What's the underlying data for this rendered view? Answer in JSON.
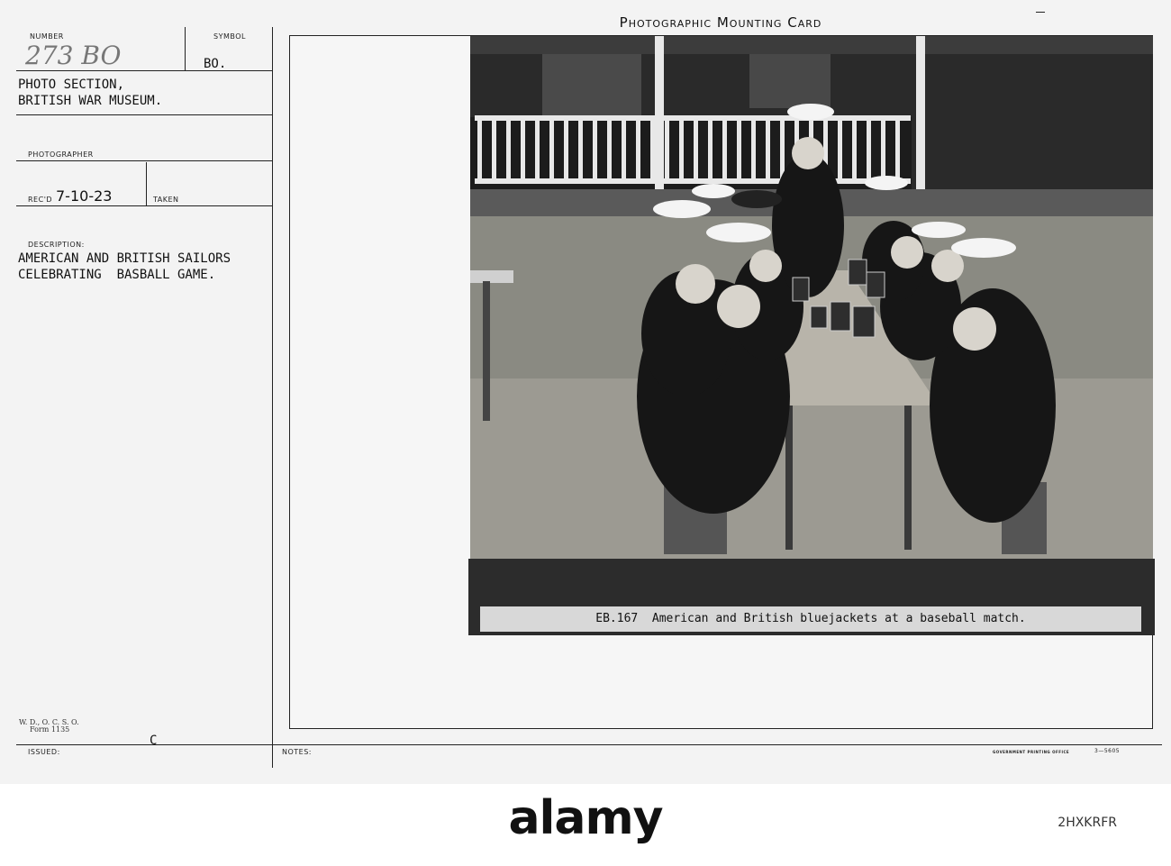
{
  "card": {
    "title": "Photographic Mounting Card",
    "number_label": "NUMBER",
    "number_value": "273 BO",
    "symbol_label": "SYMBOL",
    "symbol_value": "BO.",
    "source_line1": "PHOTO SECTION,",
    "source_line2": "BRITISH WAR MUSEUM.",
    "photographer_label": "PHOTOGRAPHER",
    "recd_label": "REC'D",
    "recd_value": "7-10-23",
    "taken_label": "TAKEN",
    "description_label": "DESCRIPTION:",
    "description_line1": "AMERICAN AND BRITISH SAILORS",
    "description_line2": "CELEBRATING  BASBALL GAME.",
    "form_line1": "W. D., O. C. S. O.",
    "form_line2": "Form 1135",
    "issued_label": "ISSUED:",
    "issued_mark": "C",
    "notes_label": "NOTES:",
    "printer": "GOVERNMENT PRINTING OFFICE",
    "print_code": "3—5605"
  },
  "photo": {
    "caption": "EB.167  American and British bluejackets at a baseball match."
  },
  "footer": {
    "logo": "alamy",
    "stock_id": "2HXKRFR"
  },
  "colors": {
    "card_bg": "#f3f3f3",
    "ink": "#111111",
    "caption_strip": "#2c2c2c"
  }
}
